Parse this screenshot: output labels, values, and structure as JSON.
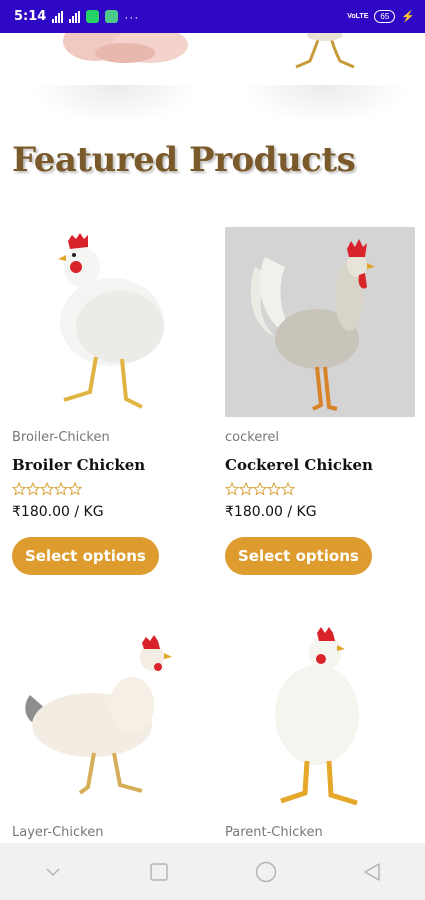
{
  "status_bar": {
    "time": "5:14",
    "network": "VoLTE",
    "battery": "65"
  },
  "section": {
    "title": "Featured Products"
  },
  "products": [
    {
      "category": "Broiler-Chicken",
      "name": "Broiler Chicken",
      "price": "₹180.00 / KG",
      "button": "Select options",
      "rating_stars": 0
    },
    {
      "category": "cockerel",
      "name": "Cockerel Chicken",
      "price": "₹180.00 / KG",
      "button": "Select options",
      "rating_stars": 0
    },
    {
      "category": "Layer-Chicken"
    },
    {
      "category": "Parent-Chicken"
    }
  ],
  "colors": {
    "status_bar": "#2f08c6",
    "title": "#7a5a2b",
    "button": "#de9c2f",
    "star_outline": "#d9a23a"
  },
  "icons": {
    "nav": [
      "chevron-down-icon",
      "recent-apps-icon",
      "home-icon",
      "back-icon"
    ]
  }
}
